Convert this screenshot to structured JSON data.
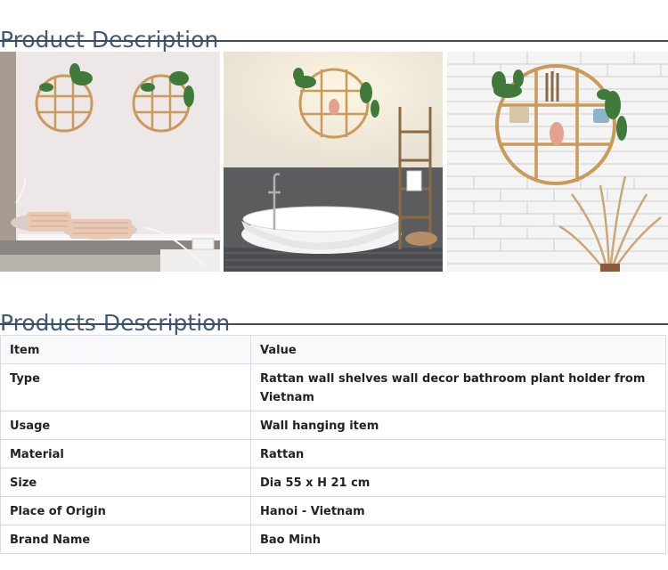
{
  "headings": {
    "product_description": "Product Description",
    "products_description": "Products Description"
  },
  "images": [
    {
      "description": "bedroom wall with two round rattan shelves and plants"
    },
    {
      "description": "bathroom with freestanding tub, round rattan shelf and ladder"
    },
    {
      "description": "white brick wall with round rattan shelf, vase and pampas grass"
    }
  ],
  "table": {
    "header": {
      "item": "Item",
      "value": "Value"
    },
    "rows": [
      {
        "item": "Type",
        "value": "Rattan wall shelves wall decor bathroom plant holder from Vietnam"
      },
      {
        "item": "Usage",
        "value": "Wall hanging item"
      },
      {
        "item": "Material",
        "value": "Rattan"
      },
      {
        "item": "Size",
        "value": "Dia 55 x H 21 cm"
      },
      {
        "item": "Place of Origin",
        "value": "Hanoi - Vietnam"
      },
      {
        "item": "Brand Name",
        "value": "Bao Minh"
      }
    ]
  },
  "colors": {
    "heading": "#3f5a7a",
    "rule": "#3f4b5c",
    "rattan": "#c99a5a",
    "table_border": "#d9dde3"
  }
}
